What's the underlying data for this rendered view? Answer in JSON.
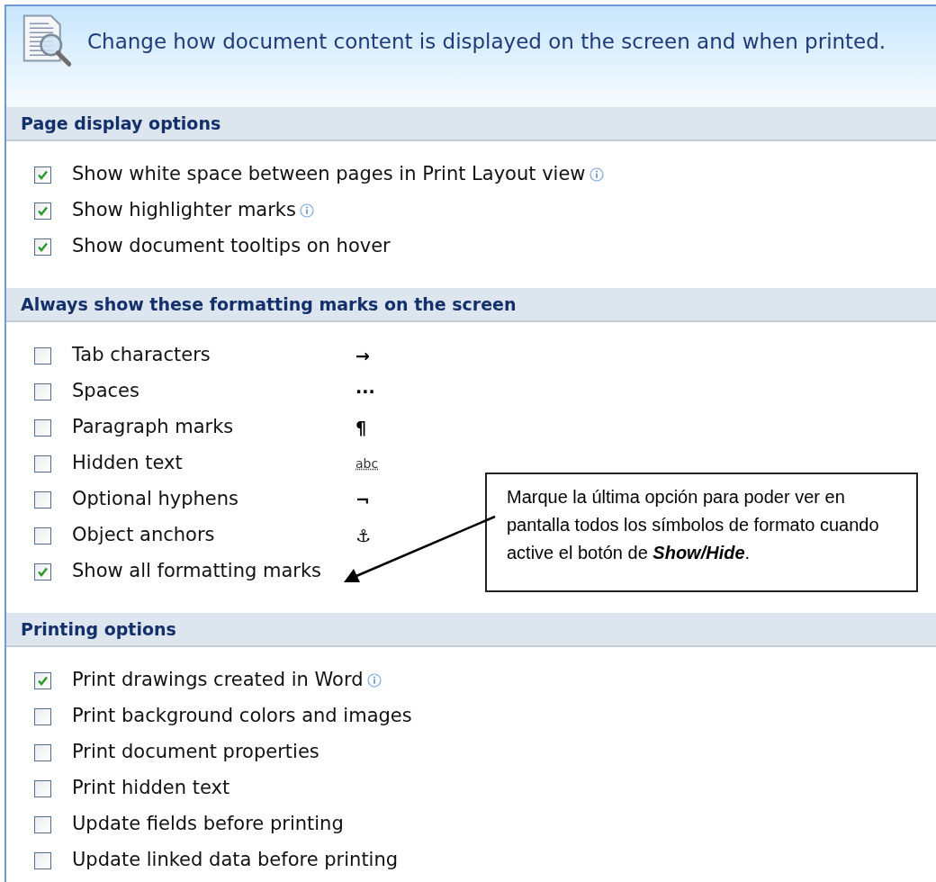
{
  "header": {
    "title": "Change how document content is displayed on the screen and when printed."
  },
  "sections": [
    {
      "title": "Page display options",
      "items": [
        {
          "kind": "option",
          "label": "Show white space between pages in Print Layout view",
          "checked": true,
          "info": true
        },
        {
          "kind": "option",
          "label": "Show highlighter marks",
          "checked": true,
          "info": true
        },
        {
          "kind": "option",
          "label": "Show document tooltips on hover",
          "checked": true,
          "info": false
        }
      ]
    },
    {
      "title": "Always show these formatting marks on the screen",
      "items": [
        {
          "kind": "mark",
          "label": "Tab characters",
          "checked": false,
          "mark": "→"
        },
        {
          "kind": "mark",
          "label": "Spaces",
          "checked": false,
          "mark": "···"
        },
        {
          "kind": "mark",
          "label": "Paragraph marks",
          "checked": false,
          "mark": "¶"
        },
        {
          "kind": "hiddenmark",
          "label": "Hidden text",
          "checked": false,
          "mark": "abc"
        },
        {
          "kind": "mark",
          "label": "Optional hyphens",
          "checked": false,
          "mark": "¬"
        },
        {
          "kind": "mark",
          "label": "Object anchors",
          "checked": false,
          "mark": "⚓"
        },
        {
          "kind": "option",
          "label": "Show all formatting marks",
          "checked": true,
          "info": false
        }
      ]
    },
    {
      "title": "Printing options",
      "items": [
        {
          "kind": "option",
          "label": "Print drawings created in Word",
          "checked": true,
          "info": true
        },
        {
          "kind": "option",
          "label": "Print background colors and images",
          "checked": false,
          "info": false
        },
        {
          "kind": "option",
          "label": "Print document properties",
          "checked": false,
          "info": false
        },
        {
          "kind": "option",
          "label": "Print hidden text",
          "checked": false,
          "info": false
        },
        {
          "kind": "option",
          "label": "Update fields before printing",
          "checked": false,
          "info": false
        },
        {
          "kind": "option",
          "label": "Update linked data before printing",
          "checked": false,
          "info": false
        }
      ]
    }
  ],
  "callout": {
    "text": "Marque la última opción para poder ver en pantalla todos los símbolos de formato cuando active el botón de **Show/Hide**."
  }
}
